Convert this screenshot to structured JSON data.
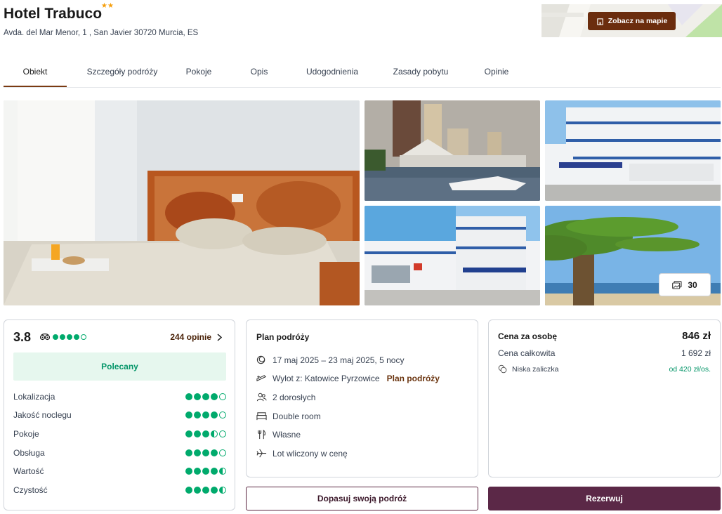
{
  "hotel": {
    "name": "Hotel Trabuco",
    "stars": "★★",
    "address": "Avda. del Mar Menor, 1 , San Javier 30720 Murcia, ES"
  },
  "map": {
    "button_label": "Zobacz na mapie"
  },
  "tabs": [
    {
      "label": "Obiekt",
      "active": true
    },
    {
      "label": "Szczegóły podróży"
    },
    {
      "label": "Pokoje"
    },
    {
      "label": "Opis"
    },
    {
      "label": "Udogodnienia"
    },
    {
      "label": "Zasady pobytu"
    },
    {
      "label": "Opinie"
    }
  ],
  "gallery": {
    "photo_count": "30"
  },
  "rating": {
    "score": "3.8",
    "tripadvisor_bubbles": 4,
    "reviews_label": "244 opinie",
    "badge": "Polecany",
    "categories": [
      {
        "label": "Lokalizacja",
        "bubbles": 4
      },
      {
        "label": "Jakość noclegu",
        "bubbles": 4
      },
      {
        "label": "Pokoje",
        "bubbles": 3.5
      },
      {
        "label": "Obsługa",
        "bubbles": 4
      },
      {
        "label": "Wartość",
        "bubbles": 4.5
      },
      {
        "label": "Czystość",
        "bubbles": 4.5
      }
    ]
  },
  "plan": {
    "title": "Plan podróży",
    "dates": "17 maj 2025 – 23 maj 2025, 5 nocy",
    "departure": "Wylot z: Katowice Pyrzowice",
    "departure_link": "Plan podróży",
    "guests": "2 dorosłych",
    "room": "Double room",
    "board": "Własne",
    "flight": "Lot wliczony w cenę"
  },
  "price": {
    "per_person_label": "Cena za osobę",
    "per_person_value": "846 zł",
    "total_label": "Cena całkowita",
    "total_value": "1 692 zł",
    "deposit_label": "Niska zaliczka",
    "deposit_value": "od 420 zł/os."
  },
  "actions": {
    "customize_label": "Dopasuj swoją podróż",
    "book_label": "Rezerwuj"
  },
  "colors": {
    "brand_brown": "#6b2d0e",
    "book_button": "#5b2847",
    "rating_green": "#00aa6c",
    "star_orange": "#f59e0b"
  }
}
